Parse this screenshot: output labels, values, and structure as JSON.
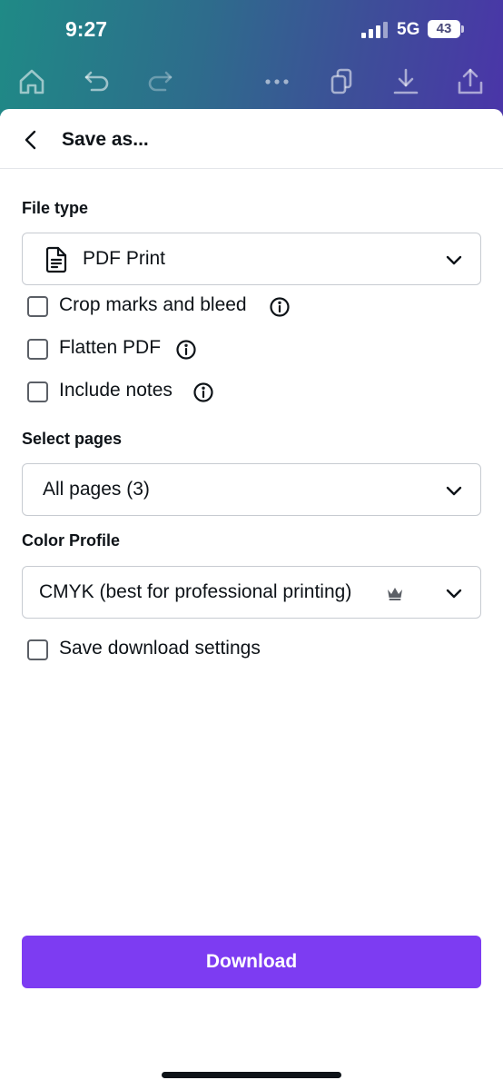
{
  "status_bar": {
    "time": "9:27",
    "network": "5G",
    "battery": "43"
  },
  "toolbar": {
    "icons": [
      "home-icon",
      "undo-icon",
      "redo-icon",
      "more-icon",
      "copy-icon",
      "download-icon",
      "share-icon"
    ]
  },
  "sheet": {
    "title": "Save as...",
    "file_type": {
      "label": "File type",
      "value": "PDF Print"
    },
    "options": [
      {
        "label": "Crop marks and bleed",
        "checked": false,
        "has_info": true
      },
      {
        "label": "Flatten PDF",
        "checked": false,
        "has_info": true
      },
      {
        "label": "Include notes",
        "checked": false,
        "has_info": true
      }
    ],
    "select_pages": {
      "label": "Select pages",
      "value": "All pages (3)"
    },
    "color_profile": {
      "label": "Color Profile",
      "value": "CMYK (best for professional printing)"
    },
    "save_settings": {
      "label": "Save download settings",
      "checked": false
    },
    "download_label": "Download"
  },
  "colors": {
    "accent": "#7d3cf2",
    "header_gradient_start": "#1f8a86",
    "header_gradient_end": "#4a35a8"
  }
}
